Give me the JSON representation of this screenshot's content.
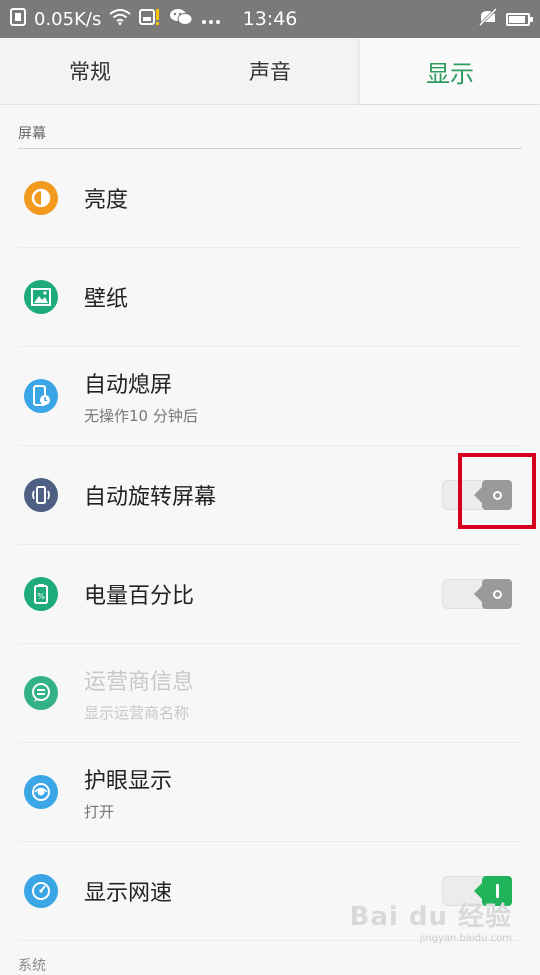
{
  "status_bar": {
    "speed": "0.05K/s",
    "time": "13:46",
    "icons": [
      "notification-icon",
      "wifi-icon",
      "sim-alert-icon",
      "wechat-icon",
      "more-icon",
      "mute-icon",
      "battery-icon"
    ]
  },
  "tabs": [
    {
      "label": "常规",
      "active": false
    },
    {
      "label": "声音",
      "active": false
    },
    {
      "label": "显示",
      "active": true
    }
  ],
  "sections": {
    "screen_title": "屏幕",
    "system_title": "系统"
  },
  "settings": [
    {
      "label": "亮度",
      "sub": "",
      "icon": "brightness-icon",
      "color": "#f29a1e"
    },
    {
      "label": "壁纸",
      "sub": "",
      "icon": "wallpaper-icon",
      "color": "#1eab7a"
    },
    {
      "label": "自动熄屏",
      "sub": "无操作10 分钟后",
      "icon": "screen-timeout-icon",
      "color": "#3aa6e6"
    },
    {
      "label": "自动旋转屏幕",
      "sub": "",
      "icon": "rotate-icon",
      "color": "#4d5f82",
      "toggle": "off"
    },
    {
      "label": "电量百分比",
      "sub": "",
      "icon": "battery-percent-icon",
      "color": "#1eab7a",
      "toggle": "off"
    },
    {
      "label": "运营商信息",
      "sub": "显示运营商名称",
      "icon": "carrier-icon",
      "color": "#1eab7a",
      "disabled": true
    },
    {
      "label": "护眼显示",
      "sub": "打开",
      "icon": "eye-care-icon",
      "color": "#3aa6e6"
    },
    {
      "label": "显示网速",
      "sub": "",
      "icon": "network-speed-icon",
      "color": "#3aa6e6",
      "toggle": "on"
    }
  ],
  "watermark": {
    "text": "Bai du 经验",
    "url": "jingyan.baidu.com"
  },
  "colors": {
    "accent": "#2e9a5e",
    "toggle_on": "#20b35a",
    "toggle_off": "#9a9a9a",
    "highlight": "#d4001c"
  }
}
